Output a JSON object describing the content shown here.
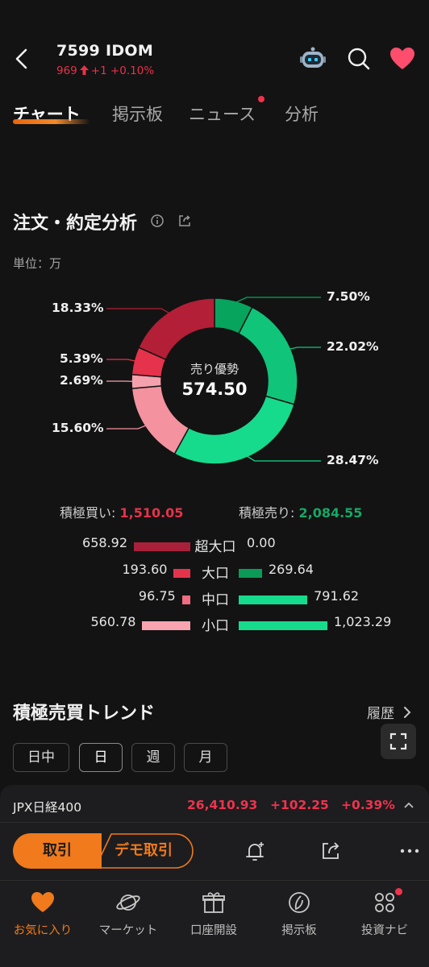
{
  "header": {
    "ticker": "7599  IDOM",
    "price": "969",
    "change": "+1 +0.10%"
  },
  "tabs": [
    {
      "label": "チャート",
      "active": true
    },
    {
      "label": "掲示板",
      "active": false
    },
    {
      "label": "ニュース",
      "active": false,
      "badge": true
    },
    {
      "label": "分析",
      "active": false
    }
  ],
  "order_analysis": {
    "title": "注文・約定分析",
    "unit": "単位：万",
    "center_label": "売り優勢",
    "center_value": "574.50",
    "chart_data": {
      "type": "pie",
      "donut": true,
      "slices": [
        {
          "label": "7.50%",
          "value": 7.5,
          "color": "#06a45c"
        },
        {
          "label": "22.02%",
          "value": 22.02,
          "color": "#10c47a"
        },
        {
          "label": "28.47%",
          "value": 28.47,
          "color": "#16db8c"
        },
        {
          "label": "15.60%",
          "value": 15.6,
          "color": "#f492a0"
        },
        {
          "label": "2.69%",
          "value": 2.69,
          "color": "#f5a1ad"
        },
        {
          "label": "5.39%",
          "value": 5.39,
          "color": "#e5334c"
        },
        {
          "label": "18.33%",
          "value": 18.33,
          "color": "#b31f36"
        }
      ]
    },
    "buy_total_label": "積極買い: ",
    "buy_total": "1,510.05",
    "sell_total_label": "積極売り: ",
    "sell_total": "2,084.55",
    "breakdown": [
      {
        "label": "超大口",
        "buy": "658.92",
        "buy_value": 658.92,
        "sell": "0.00",
        "sell_value": 0,
        "buy_color": "#a9203a"
      },
      {
        "label": "大口",
        "buy": "193.60",
        "buy_value": 193.6,
        "sell": "269.64",
        "sell_value": 269.64,
        "buy_color": "#e5334c"
      },
      {
        "label": "中口",
        "buy": "96.75",
        "buy_value": 96.75,
        "sell": "791.62",
        "sell_value": 791.62,
        "buy_color": "#f06c80"
      },
      {
        "label": "小口",
        "buy": "560.78",
        "buy_value": 560.78,
        "sell": "1,023.29",
        "sell_value": 1023.29,
        "buy_color": "#f7a3b0"
      }
    ]
  },
  "trend": {
    "title": "積極売買トレンド",
    "history_label": "履歴",
    "periods": [
      {
        "label": "日中",
        "active": false
      },
      {
        "label": "日",
        "active": true
      },
      {
        "label": "週",
        "active": false
      },
      {
        "label": "月",
        "active": false
      }
    ]
  },
  "index": {
    "name": "JPX日経400",
    "value": "26,410.93",
    "change": "+102.25",
    "change_pct": "+0.39%"
  },
  "actions": {
    "trade": "取引",
    "demo": "デモ取引"
  },
  "bottom_nav": [
    {
      "label": "お気に入り",
      "icon": "heart-icon",
      "active": true
    },
    {
      "label": "マーケット",
      "icon": "planet-icon",
      "active": false
    },
    {
      "label": "口座開設",
      "icon": "gift-icon",
      "active": false
    },
    {
      "label": "掲示板",
      "icon": "board-icon",
      "active": false
    },
    {
      "label": "投資ナビ",
      "icon": "navi-icon",
      "active": false
    }
  ],
  "colors": {
    "accent": "#f07a1c",
    "up_red": "#e6334a",
    "down_green": "#14a866",
    "favorite": "#ff4d6d"
  }
}
